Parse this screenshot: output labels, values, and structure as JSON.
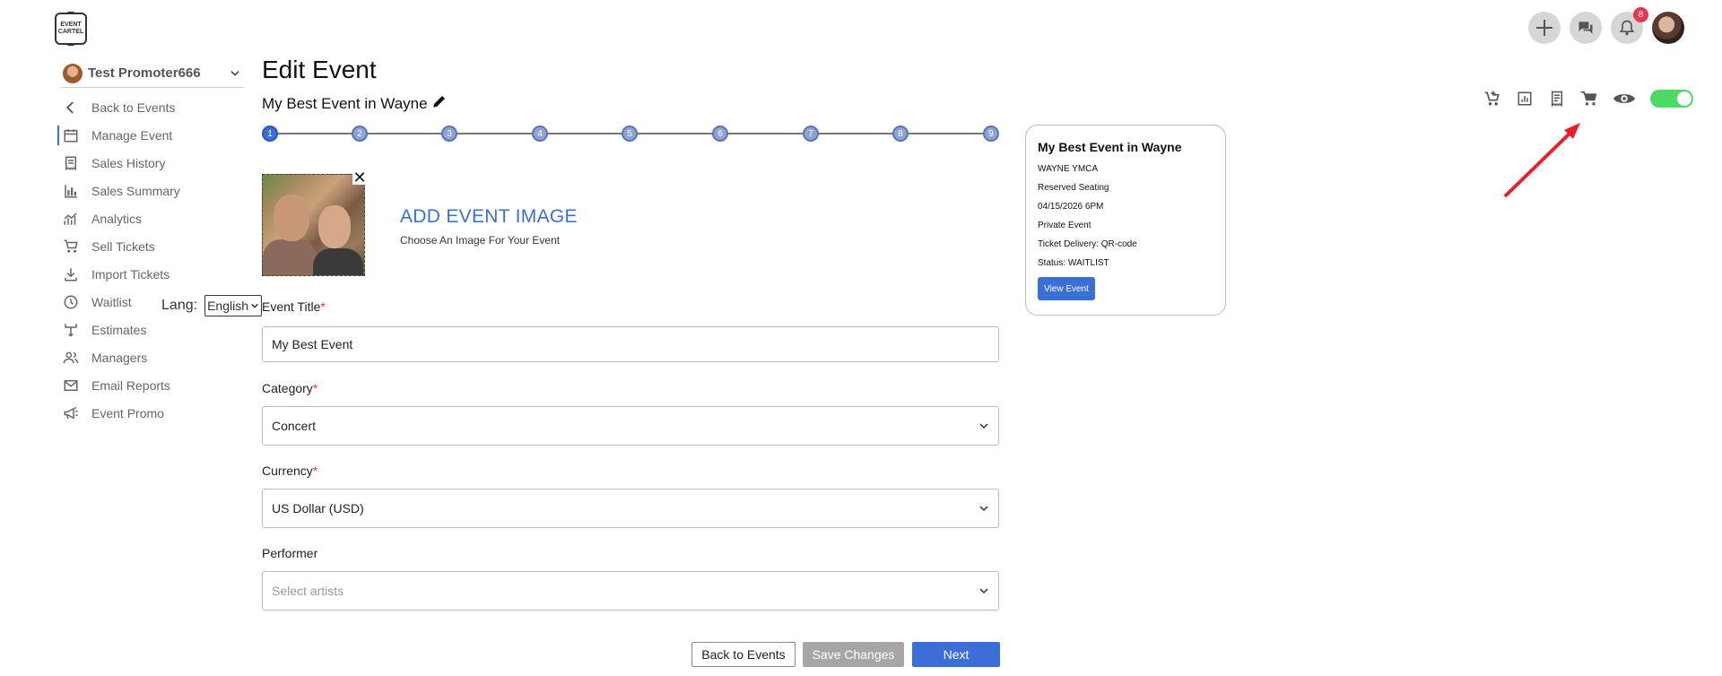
{
  "logo": {
    "line1": "EVENT",
    "line2": "CARTEL"
  },
  "header": {
    "notifications_count": "8"
  },
  "sidebar": {
    "promoter_name": "Test Promoter666",
    "items": [
      {
        "label": "Back to Events",
        "icon": "chevron-left-icon"
      },
      {
        "label": "Manage Event",
        "icon": "calendar-icon"
      },
      {
        "label": "Sales History",
        "icon": "receipt-icon"
      },
      {
        "label": "Sales Summary",
        "icon": "bar-chart-icon"
      },
      {
        "label": "Analytics",
        "icon": "analytics-icon"
      },
      {
        "label": "Sell Tickets",
        "icon": "cart-icon"
      },
      {
        "label": "Import Tickets",
        "icon": "download-icon"
      },
      {
        "label": "Waitlist",
        "icon": "clock-icon"
      },
      {
        "label": "Estimates",
        "icon": "fork-icon"
      },
      {
        "label": "Managers",
        "icon": "people-icon"
      },
      {
        "label": "Email Reports",
        "icon": "mail-icon"
      },
      {
        "label": "Event Promo",
        "icon": "megaphone-icon"
      }
    ]
  },
  "main": {
    "title": "Edit Event",
    "subtitle": "My Best Event in Wayne",
    "steps": [
      "1",
      "2",
      "3",
      "4",
      "5",
      "6",
      "7",
      "8",
      "9"
    ],
    "add_image_title": "ADD EVENT IMAGE",
    "add_image_sub": "Choose An Image For Your Event",
    "lang_label": "Lang:",
    "lang_value": "English",
    "event_title_label": "Event Title",
    "event_title_value": "My Best Event",
    "category_label": "Category",
    "category_value": "Concert",
    "currency_label": "Currency",
    "currency_value": "US Dollar (USD)",
    "performer_label": "Performer",
    "performer_placeholder": "Select artists",
    "required_mark": "*",
    "buttons": {
      "back": "Back to Events",
      "save": "Save Changes",
      "next": "Next"
    }
  },
  "card": {
    "title": "My Best Event in Wayne",
    "venue": "WAYNE YMCA",
    "seating": "Reserved Seating",
    "datetime": "04/15/2026 6PM",
    "privacy": "Private Event",
    "delivery": "Ticket Delivery: QR-code",
    "status": "Status: WAITLIST",
    "button": "View Event"
  },
  "colors": {
    "accent": "#3a6fd8",
    "toggle_on": "#4cd964",
    "badge": "#e8364f",
    "annotation_arrow": "#e8202a"
  }
}
